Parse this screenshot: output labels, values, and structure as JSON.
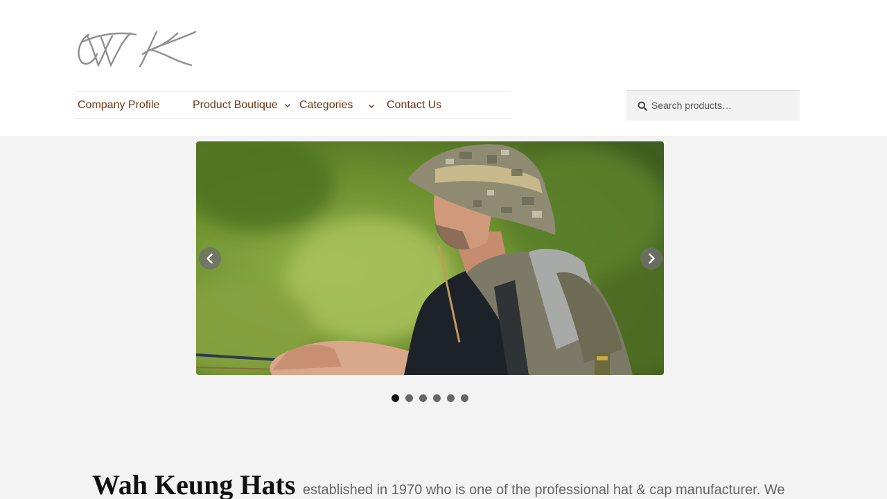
{
  "logo": {
    "text": "WK",
    "icon": "wk-monogram-logo"
  },
  "nav": {
    "items": [
      {
        "label": "Company Profile",
        "has_dropdown": false
      },
      {
        "label": "Product Boutique",
        "has_dropdown": true
      },
      {
        "label": "Categories",
        "has_dropdown": true
      },
      {
        "label": "Contact Us",
        "has_dropdown": false
      }
    ]
  },
  "search": {
    "placeholder": "Search products…",
    "icon": "search-icon"
  },
  "slider": {
    "image": "man in camouflage bucket hat with backpack fly fishing",
    "prev_icon": "chevron-left-icon",
    "next_icon": "chevron-right-icon",
    "slide_count": 6,
    "active_index": 0
  },
  "intro": {
    "brand": "Wah Keung Hats",
    "text": "established in 1970 who is one of the professional hat & cap manufacturer. We"
  },
  "colors": {
    "nav_text": "#6b3414",
    "page_bg": "#f3f3f3",
    "header_bg": "#ffffff",
    "dot_active": "#111111",
    "dot_inactive": "#666666"
  }
}
